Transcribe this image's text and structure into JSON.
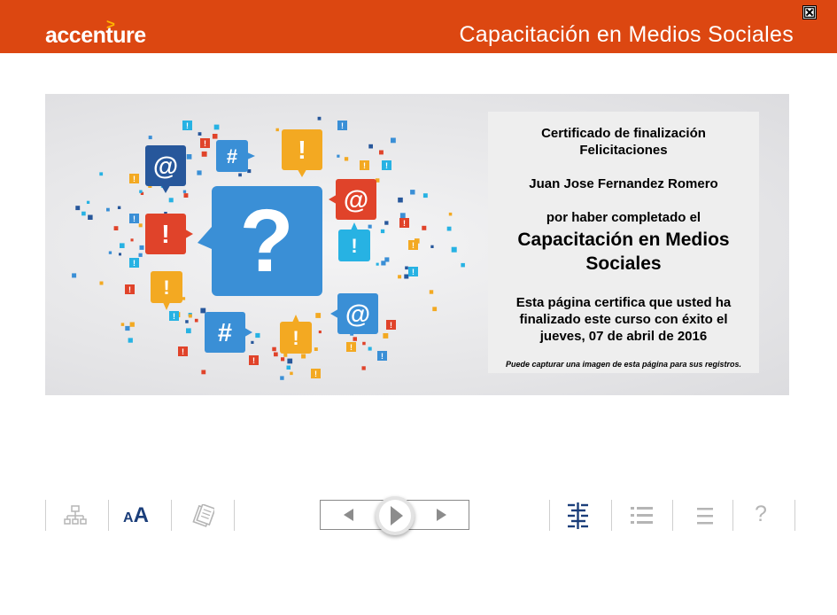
{
  "header": {
    "logo_text": "accenture",
    "logo_mark": ">",
    "course_title": "Capacitación en Medios Sociales",
    "close_icon": "close-x-icon"
  },
  "certificate": {
    "heading_line1": "Certificado de finalización",
    "heading_line2": "Felicitaciones",
    "recipient_name": "Juan Jose Fernandez Romero",
    "completion_intro": "por haber completado el",
    "course_line1": "Capacitación en Medios",
    "course_line2": "Sociales",
    "body_line1": "Esta página certifica que usted ha",
    "body_line2": "finalizado este curso con éxito el",
    "body_line3": "jueves, 07 de abril de 2016",
    "note": "Puede capturar una imagen de esta página para sus registros."
  },
  "banner_art": {
    "center_glyph": "?",
    "bubble_glyphs": [
      "@",
      "#",
      "!",
      "@",
      "!",
      "!",
      "!",
      "#",
      "@",
      "!"
    ],
    "colors": {
      "blue": "#3a8fd6",
      "navy": "#27579b",
      "red": "#e0432a",
      "orange": "#f3a922",
      "cyan": "#27b2e3"
    }
  },
  "toolbar": {
    "left_icons": [
      "sitemap-icon",
      "text-size-icon",
      "notes-icon"
    ],
    "nav_icons": [
      "previous-icon",
      "play-icon",
      "next-icon"
    ],
    "right_icons": [
      "glossary-icon",
      "list-icon",
      "menu-icon",
      "help-icon"
    ],
    "text_size_small": "A",
    "text_size_large": "A",
    "help_glyph": "?"
  },
  "colors": {
    "header_bg": "#dc4711",
    "accent_mark": "#ffb400",
    "icon_active": "#1b3e7a",
    "icon_inactive": "#b5b5b5"
  }
}
